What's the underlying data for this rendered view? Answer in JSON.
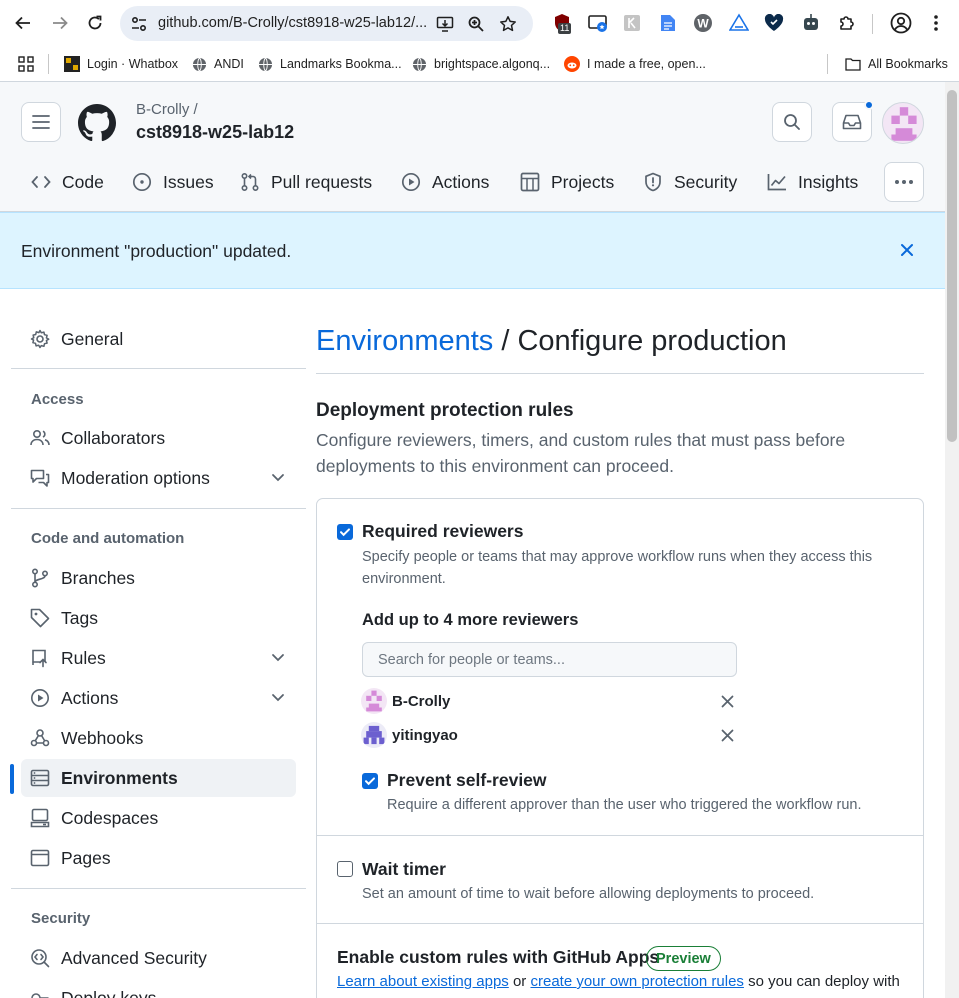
{
  "browser": {
    "url": "github.com/B-Crolly/cst8918-w25-lab12/...",
    "extension_badge": "11",
    "bookmarks": [
      {
        "label": "Login · Whatbox",
        "icon": "whatbox-favicon"
      },
      {
        "label": "ANDI",
        "icon": "globe-favicon"
      },
      {
        "label": "Landmarks Bookma...",
        "icon": "globe-favicon"
      },
      {
        "label": "brightspace.algonq...",
        "icon": "globe-favicon"
      },
      {
        "label": "I made a free, open...",
        "icon": "reddit-favicon"
      }
    ],
    "all_bookmarks": "All Bookmarks"
  },
  "repo": {
    "owner": "B-Crolly /",
    "name": "cst8918-w25-lab12"
  },
  "tabs": [
    {
      "label": "Code",
      "icon": "code-icon"
    },
    {
      "label": "Issues",
      "icon": "issue-icon"
    },
    {
      "label": "Pull requests",
      "icon": "pull-request-icon"
    },
    {
      "label": "Actions",
      "icon": "play-icon"
    },
    {
      "label": "Projects",
      "icon": "table-icon"
    },
    {
      "label": "Security",
      "icon": "shield-icon"
    },
    {
      "label": "Insights",
      "icon": "graph-icon"
    }
  ],
  "flash": {
    "message": "Environment \"production\" updated."
  },
  "sidebar": {
    "general": "General",
    "access_heading": "Access",
    "collaborators": "Collaborators",
    "moderation": "Moderation options",
    "code_heading": "Code and automation",
    "branches": "Branches",
    "tags": "Tags",
    "rules": "Rules",
    "actions": "Actions",
    "webhooks": "Webhooks",
    "environments": "Environments",
    "codespaces": "Codespaces",
    "pages": "Pages",
    "security_heading": "Security",
    "advanced_security": "Advanced Security",
    "deploy_keys": "Deploy keys"
  },
  "main": {
    "breadcrumb_link": "Environments",
    "breadcrumb_sep": " / ",
    "breadcrumb_current": "Configure production",
    "section_title": "Deployment protection rules",
    "section_desc": "Configure reviewers, timers, and custom rules that must pass before deployments to this environment can proceed.",
    "required_reviewers": {
      "checked": true,
      "label": "Required reviewers",
      "desc": "Specify people or teams that may approve workflow runs when they access this environment.",
      "add_label": "Add up to 4 more reviewers",
      "search_placeholder": "Search for people or teams...",
      "reviewers": [
        "B-Crolly",
        "yitingyao"
      ]
    },
    "prevent_self_review": {
      "checked": true,
      "label": "Prevent self-review",
      "desc": "Require a different approver than the user who triggered the workflow run."
    },
    "wait_timer": {
      "checked": false,
      "label": "Wait timer",
      "desc": "Set an amount of time to wait before allowing deployments to proceed."
    },
    "custom_rules": {
      "title": "Enable custom rules with GitHub Apps",
      "badge": "Preview",
      "link1": "Learn about existing apps",
      "or": " or ",
      "link2": "create your own protection rules",
      "tail": " so you can deploy with"
    }
  },
  "colors": {
    "accent": "#0969da",
    "flash_bg": "#ddf4ff",
    "success": "#1a7f37"
  }
}
